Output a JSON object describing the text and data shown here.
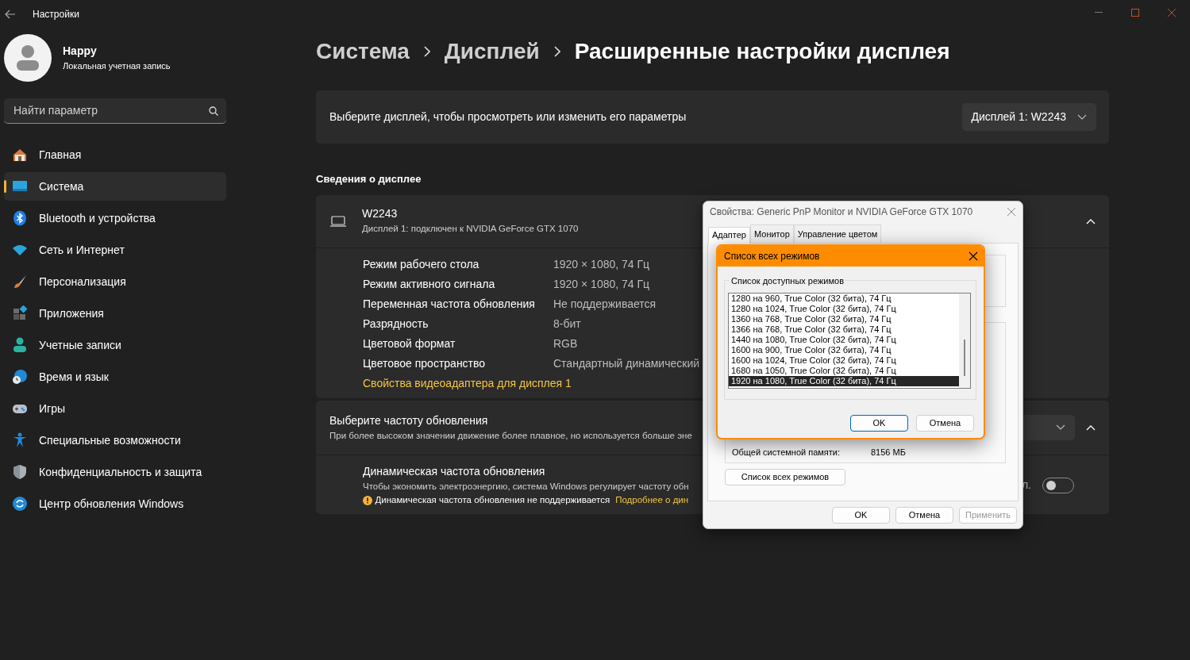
{
  "window": {
    "title": "Настройки"
  },
  "profile": {
    "name": "Happy",
    "account": "Локальная учетная запись"
  },
  "search": {
    "placeholder": "Найти параметр"
  },
  "sidebar": {
    "items": [
      {
        "label": "Главная",
        "selected": false
      },
      {
        "label": "Система",
        "selected": true
      },
      {
        "label": "Bluetooth и устройства",
        "selected": false
      },
      {
        "label": "Сеть и Интернет",
        "selected": false
      },
      {
        "label": "Персонализация",
        "selected": false
      },
      {
        "label": "Приложения",
        "selected": false
      },
      {
        "label": "Учетные записи",
        "selected": false
      },
      {
        "label": "Время и язык",
        "selected": false
      },
      {
        "label": "Игры",
        "selected": false
      },
      {
        "label": "Специальные возможности",
        "selected": false
      },
      {
        "label": "Конфиденциальность и защита",
        "selected": false
      },
      {
        "label": "Центр обновления Windows",
        "selected": false
      }
    ]
  },
  "breadcrumb": [
    "Система",
    "Дисплей",
    "Расширенные настройки дисплея"
  ],
  "display_select": {
    "label": "Выберите дисплей, чтобы просмотреть или изменить его параметры",
    "value": "Дисплей 1: W2243"
  },
  "section_title": "Сведения о дисплее",
  "display_info": {
    "name": "W2243",
    "subtitle": "Дисплей 1: подключен к NVIDIA GeForce GTX 1070",
    "expanded": true,
    "rows": [
      {
        "label": "Режим рабочего стола",
        "value": "1920 × 1080, 74 Гц"
      },
      {
        "label": "Режим активного сигнала",
        "value": "1920 × 1080, 74 Гц"
      },
      {
        "label": "Переменная частота обновления",
        "value": "Не поддерживается"
      },
      {
        "label": "Разрядность",
        "value": "8-бит"
      },
      {
        "label": "Цветовой формат",
        "value": "RGB"
      },
      {
        "label": "Цветовое пространство",
        "value": "Стандартный динамический"
      }
    ],
    "link": "Свойства видеоадаптера для дисплея 1"
  },
  "refresh": {
    "title": "Выберите частоту обновления",
    "description": "При более высоком значении движение более плавное, но используется больше эне",
    "expanded": true,
    "dynamic": {
      "title": "Динамическая частота обновления",
      "description": "Чтобы экономить электроэнергию, система Windows регулирует частоту обн",
      "warning": "Динамическая частота обновления не поддерживается",
      "link": "Подробнее о дин",
      "toggle_label": "л.",
      "on": false
    }
  },
  "properties_dialog": {
    "title": "Свойства: Generic PnP Monitor и NVIDIA GeForce GTX 1070",
    "tabs": [
      {
        "label": "Адаптер",
        "selected": true
      },
      {
        "label": "Монитор",
        "selected": false
      },
      {
        "label": "Управление цветом",
        "selected": false
      }
    ],
    "memory_label": "Общей системной памяти:",
    "memory_value": "8156 МБ",
    "list_button": "Список всех режимов",
    "buttons": [
      {
        "label": "OK",
        "disabled": false
      },
      {
        "label": "Отмена",
        "disabled": false
      },
      {
        "label": "Применить",
        "disabled": true
      }
    ]
  },
  "modes_dialog": {
    "title": "Список всех режимов",
    "group_label": "Список доступных режимов",
    "modes": [
      {
        "label": "1280 на 960, True Color (32 бита), 74 Гц",
        "selected": false
      },
      {
        "label": "1280 на 1024, True Color (32 бита), 74 Гц",
        "selected": false
      },
      {
        "label": "1360 на 768, True Color (32 бита), 74 Гц",
        "selected": false
      },
      {
        "label": "1366 на 768, True Color (32 бита), 74 Гц",
        "selected": false
      },
      {
        "label": "1440 на 1080, True Color (32 бита), 74 Гц",
        "selected": false
      },
      {
        "label": "1600 на 900, True Color (32 бита), 74 Гц",
        "selected": false
      },
      {
        "label": "1600 на 1024, True Color (32 бита), 74 Гц",
        "selected": false
      },
      {
        "label": "1680 на 1050, True Color (32 бита), 74 Гц",
        "selected": false
      },
      {
        "label": "1920 на 1080, True Color (32 бита), 74 Гц",
        "selected": true
      }
    ],
    "buttons": [
      {
        "label": "OK",
        "default": true
      },
      {
        "label": "Отмена",
        "default": false
      }
    ]
  }
}
